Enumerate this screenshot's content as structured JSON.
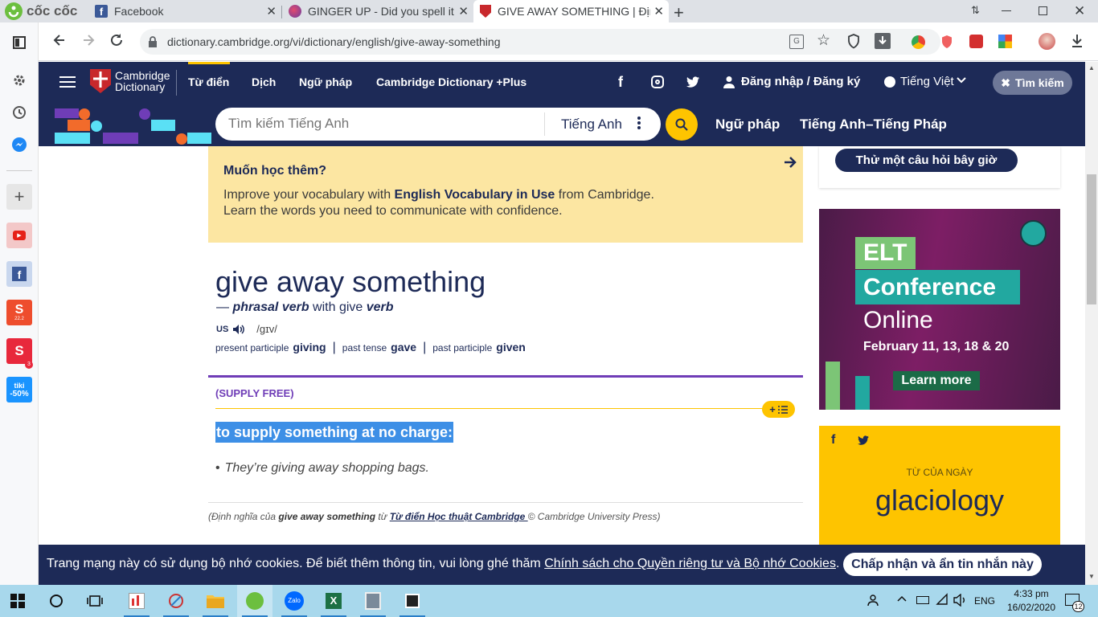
{
  "browser": {
    "brand": "cốc cốc",
    "tabs": [
      {
        "title": "Facebook"
      },
      {
        "title": "GINGER UP - Did you spell it c"
      },
      {
        "title": "GIVE AWAY SOMETHING | Địn"
      }
    ],
    "url": "dictionary.cambridge.org/vi/dictionary/english/give-away-something",
    "badge_count": "3"
  },
  "site": {
    "logo_line1": "Cambridge",
    "logo_line2": "Dictionary",
    "nav": [
      "Từ điển",
      "Dịch",
      "Ngữ pháp",
      "Cambridge Dictionary +Plus"
    ],
    "login": "Đăng nhập / Đăng ký",
    "language": "Tiếng Việt",
    "search_toggle": "Tìm kiếm",
    "search_placeholder": "Tìm kiếm Tiếng Anh",
    "search_lang": "Tiếng Anh",
    "sub_links": [
      "Ngữ pháp",
      "Tiếng Anh–Tiếng Pháp"
    ]
  },
  "promo": {
    "title": "Muốn học thêm?",
    "line1_pre": "Improve your vocabulary with ",
    "line1_bold": "English Vocabulary in Use",
    "line1_post": " from Cambridge.",
    "line2": "Learn the words you need to communicate with confidence."
  },
  "entry": {
    "headword": "give away something",
    "dash": "— ",
    "pos": "phrasal verb",
    "with_text": " with give ",
    "with_pos": "verb",
    "region": "US",
    "ipa": "/ɡɪv/",
    "forms": [
      {
        "label": "present participle",
        "value": "giving"
      },
      {
        "label": "past tense",
        "value": "gave"
      },
      {
        "label": "past participle",
        "value": "given"
      }
    ],
    "guideword": "(SUPPLY FREE)",
    "add_button": "+",
    "definition": "to supply something at no charge:",
    "example": "They’re giving away shopping bags.",
    "credit_pre": "(Định nghĩa của ",
    "credit_word": "give away something",
    "credit_mid": " từ ",
    "credit_link": "Từ điển Học thuật Cambridge ",
    "credit_post": " © Cambridge University Press)"
  },
  "sidebar_right": {
    "quiz_button": "Thử một câu hỏi bây giờ",
    "ad": {
      "tag1": "ELT",
      "tag2": "Conference",
      "line3": "Online",
      "dates": "February 11, 13, 18 & 20",
      "cta": "Learn more"
    },
    "wotd_label": "TỪ CỦA NGÀY",
    "wotd_word": "glaciology"
  },
  "cookie": {
    "text": "Trang mạng này có sử dụng bộ nhớ cookies. Để biết thêm thông tin, vui lòng ghé thăm ",
    "link": "Chính sách cho Quyền riêng tư và Bộ nhớ Cookies",
    "end": ".",
    "accept": "Chấp nhận và ẩn tin nhắn này"
  },
  "sidebar_badges": {
    "shopee": "22.2",
    "tiki_line1": "tiki",
    "tiki_line2": "-50%"
  },
  "taskbar": {
    "lang": "ENG",
    "time": "4:33 pm",
    "date": "16/02/2020",
    "notif": "12",
    "zalo": "Zalo"
  },
  "colors": {
    "navy": "#1d2a57",
    "promo_bg": "#fce6a2",
    "divider_purple": "#6f3db7",
    "highlight": "#3d8fe6",
    "wotd_bg": "#fec400"
  }
}
